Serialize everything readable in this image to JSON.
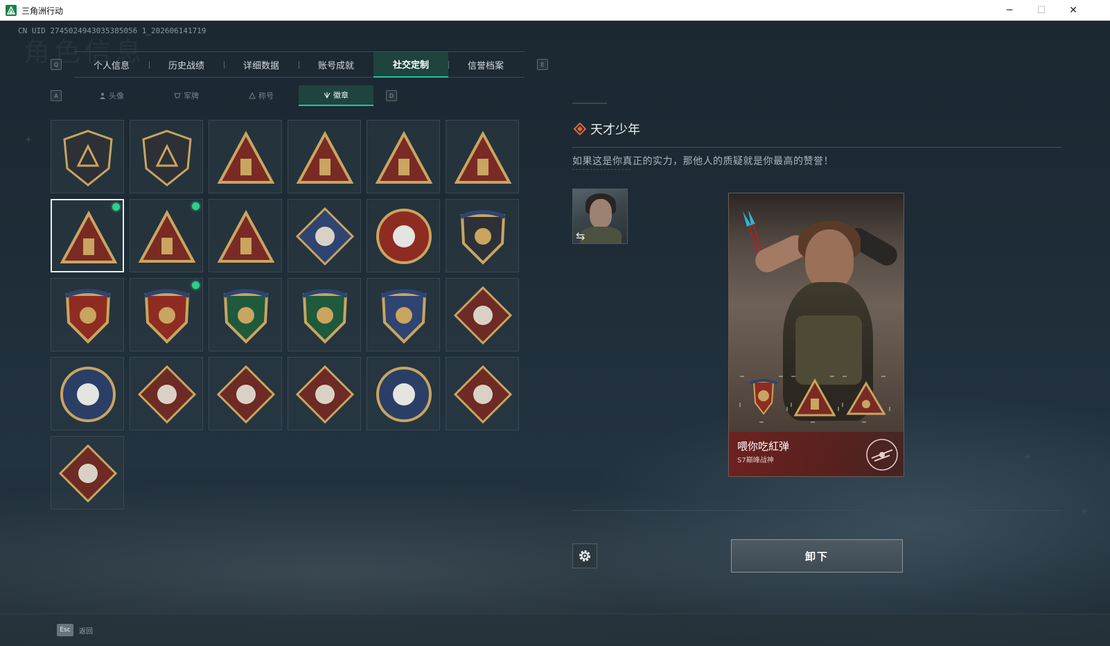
{
  "window": {
    "title": "三角洲行动",
    "minimize": "─",
    "maximize": "☐",
    "close": "✕"
  },
  "page": {
    "bg_title": "角色信息",
    "uid": "CN UID 2745024943035385056 1_202606141719"
  },
  "main_tabs": {
    "left_key": "Q",
    "right_key": "E",
    "items": [
      {
        "label": "个人信息"
      },
      {
        "label": "历史战绩"
      },
      {
        "label": "详细数据"
      },
      {
        "label": "账号成就"
      },
      {
        "label": "社交定制",
        "active": true
      },
      {
        "label": "信誉档案"
      }
    ]
  },
  "sub_tabs": {
    "left_key": "A",
    "right_key": "D",
    "items": [
      {
        "label": "头像",
        "icon": "person-icon"
      },
      {
        "label": "军牌",
        "icon": "dogtag-icon"
      },
      {
        "label": "称号",
        "icon": "title-icon"
      },
      {
        "label": "徽章",
        "icon": "emblem-icon",
        "active": true
      }
    ]
  },
  "badges": [
    {
      "name": "delta-shield-badge",
      "color": "#2d3137",
      "selected": false,
      "new": false
    },
    {
      "name": "helicopter-badge",
      "color": "#2d3137",
      "selected": false,
      "new": false
    },
    {
      "name": "s7-season-badge",
      "color": "#7a2a24",
      "selected": false,
      "new": false
    },
    {
      "name": "s8-season-badge",
      "color": "#7a2a24",
      "selected": false,
      "new": false
    },
    {
      "name": "s9-season-badge",
      "color": "#7a2a24",
      "selected": false,
      "new": false
    },
    {
      "name": "rank-one-badge",
      "color": "#7a2a24",
      "selected": false,
      "new": false
    },
    {
      "name": "usb-triangle-badge",
      "color": "#7a2a24",
      "selected": true,
      "new": true
    },
    {
      "name": "hands-triangle-badge",
      "color": "#7a2a24",
      "selected": false,
      "new": true
    },
    {
      "name": "squad-triangle-badge",
      "color": "#7a2a24",
      "selected": false,
      "new": false
    },
    {
      "name": "rose-diamond-badge",
      "color": "#2f4470",
      "selected": false,
      "new": false
    },
    {
      "name": "star-medal-badge",
      "color": "#8e2c22",
      "selected": false,
      "new": false
    },
    {
      "name": "dark-shield-badge",
      "color": "#2d3137",
      "selected": false,
      "new": false
    },
    {
      "name": "laurel-shield-badge",
      "color": "#8e2c22",
      "selected": false,
      "new": false
    },
    {
      "name": "gem-shield-badge",
      "color": "#8e2c22",
      "selected": false,
      "new": true
    },
    {
      "name": "rifle-green-shield-badge",
      "color": "#1f5a3c",
      "selected": false,
      "new": false
    },
    {
      "name": "sniper-green-shield-badge",
      "color": "#1f5a3c",
      "selected": false,
      "new": false
    },
    {
      "name": "crosshair-gold-shield-badge",
      "color": "#2f4470",
      "selected": false,
      "new": false
    },
    {
      "name": "wolf-diamond-badge",
      "color": "#6e2b25",
      "selected": false,
      "new": false
    },
    {
      "name": "eagle-round-badge",
      "color": "#2b3f66",
      "selected": false,
      "new": false
    },
    {
      "name": "dragon-diamond-badge",
      "color": "#6e2b25",
      "selected": false,
      "new": false
    },
    {
      "name": "dragon-diamond-2-badge",
      "color": "#6e2b25",
      "selected": false,
      "new": false
    },
    {
      "name": "runner-diamond-badge",
      "color": "#6e2b25",
      "selected": false,
      "new": false
    },
    {
      "name": "wolf-round-badge",
      "color": "#2b3f66",
      "selected": false,
      "new": false
    },
    {
      "name": "horse-diamond-badge",
      "color": "#6e2b25",
      "selected": false,
      "new": false
    },
    {
      "name": "flare-diamond-badge",
      "color": "#6e2b25",
      "selected": false,
      "new": false
    }
  ],
  "detail": {
    "title": "天才少年",
    "description": "如果这是你真正的实力，那他人的质疑就是你最高的赞誉！"
  },
  "card": {
    "player_name": "喂你吃紅弹",
    "player_sub": "S7巅峰战神"
  },
  "actions": {
    "settings_icon": "gear-icon",
    "unequip_label": "卸下"
  },
  "footer": {
    "esc_key": "Esc",
    "esc_label": "返回"
  },
  "colors": {
    "accent": "#21c59a",
    "new_dot": "#2ed08a",
    "badge_gold": "#c9a560"
  }
}
